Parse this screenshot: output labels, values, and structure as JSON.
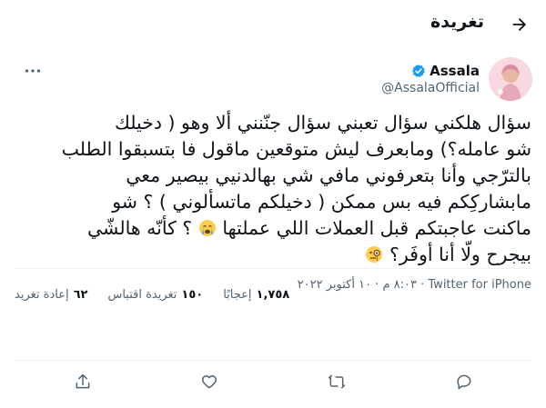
{
  "header": {
    "title": "تغريدة"
  },
  "author": {
    "display_name": "Assala",
    "handle": "@AssalaOfficial"
  },
  "tweet": {
    "line1": "سؤال هلكني سؤال تعبني سؤال جنّنني ألا وهو ( دخيلك",
    "line2": "شو عامله؟) ومابعرف ليش متوقعين ماقول فا بتسبقوا الطلب",
    "line3": "بالترّجي وأنا بتعرفوني مافي شي بهالدنيي بيصير معي",
    "line4": "مابشاركِكم فيه بس ممكن ( دخيلكم ماتسألوني ) ؟ شو",
    "line5a": "ماكنت عاجبتكم قبل العملات اللي عملتها",
    "line5b": "؟ كأنّه هالشّي",
    "line6a": "بيجرح ولّا أنا أوفَر؟",
    "emoji1": "crying-face-emoji",
    "emoji2": "monocle-face-emoji"
  },
  "meta": {
    "text": "٨:٠٣ م · ١٠ أكتوبر ٢٠٢٢ · Twitter for iPhone"
  },
  "stats": [
    {
      "num": "٦٢",
      "label": "إعادة تغريد"
    },
    {
      "num": "١٥٠",
      "label": "تغريدة اقتباس"
    },
    {
      "num": "١,٧٥٨",
      "label": "إعجابًا"
    }
  ],
  "colors": {
    "verified": "#1d9bf0",
    "secondary_text": "#536471",
    "divider": "#eff3f4"
  }
}
